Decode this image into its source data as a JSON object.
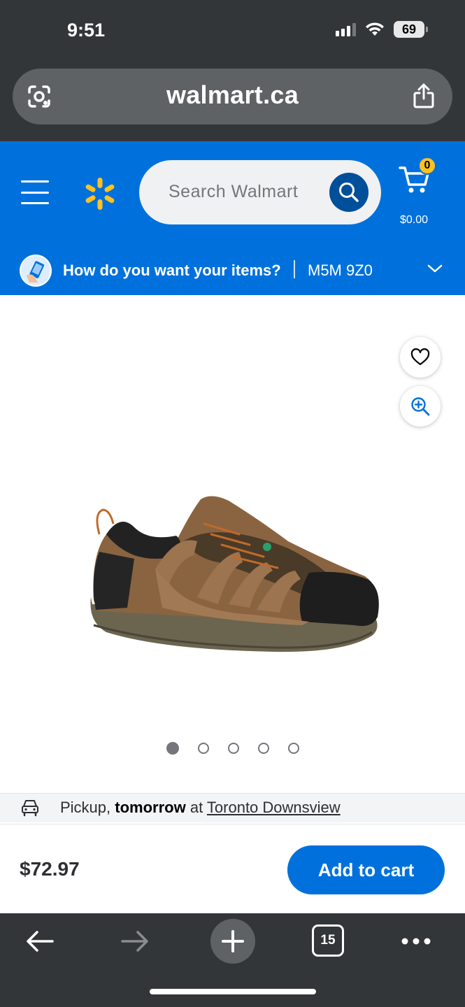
{
  "status_bar": {
    "time": "9:51",
    "battery": "69"
  },
  "browser": {
    "url": "walmart.ca",
    "tab_count": "15"
  },
  "header": {
    "search_placeholder": "Search Walmart",
    "cart_count": "0",
    "cart_total": "$0.00",
    "fulfillment_question": "How do you want your items?",
    "postal_code": "M5M 9Z0"
  },
  "product": {
    "image_count": 5,
    "active_image_index": 0
  },
  "pickup": {
    "prefix": "Pickup, ",
    "when": "tomorrow",
    "at": " at ",
    "store": "Toronto Downsview"
  },
  "buy": {
    "price": "$72.97",
    "add_to_cart_label": "Add to cart"
  },
  "colors": {
    "walmart_blue": "#0071dc",
    "walmart_dark_blue": "#004f9a",
    "spark_yellow": "#ffc220",
    "browser_chrome": "#333639"
  }
}
